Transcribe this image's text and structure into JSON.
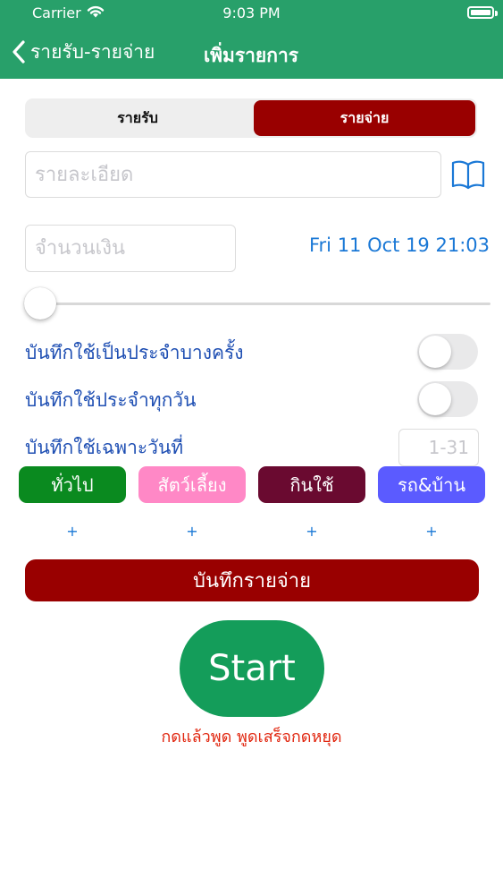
{
  "status_bar": {
    "carrier": "Carrier",
    "time": "9:03 PM"
  },
  "nav": {
    "back_label": "รายรับ-รายจ่าย",
    "title": "เพิ่มรายการ"
  },
  "segment": {
    "income": "รายรับ",
    "expense": "รายจ่าย",
    "selected": "expense"
  },
  "detail": {
    "placeholder": "รายละเอียด",
    "value": ""
  },
  "amount": {
    "placeholder": "จำนวนเงิน",
    "value": ""
  },
  "datetime": "Fri 11 Oct 19 21:03",
  "slider": {
    "value": 0
  },
  "options": {
    "occasional_label": "บันทึกใช้เป็นประจำบางครั้ง",
    "occasional_on": false,
    "daily_label": "บันทึกใช้ประจำทุกวัน",
    "daily_on": false,
    "specific_day_label": "บันทึกใช้เฉพาะวันที่",
    "specific_day_placeholder": "1-31"
  },
  "categories": [
    {
      "label": "ทั่วไป",
      "color": "#0a8a1f"
    },
    {
      "label": "สัตว์เลี้ยง",
      "color": "#ff88c6"
    },
    {
      "label": "กินใช้",
      "color": "#6a0a30"
    },
    {
      "label": "รถ&บ้าน",
      "color": "#5b5bff"
    }
  ],
  "add_symbol": "+",
  "save_button": "บันทึกรายจ่าย",
  "start_button": "Start",
  "hint": "กดแล้วพูด พูดเสร็จกดหยุด",
  "colors": {
    "header": "#28a06a",
    "expense": "#990000",
    "start": "#149d5a",
    "link": "#1a78d6",
    "label": "#1f4fb3",
    "hint": "#e1260f"
  }
}
